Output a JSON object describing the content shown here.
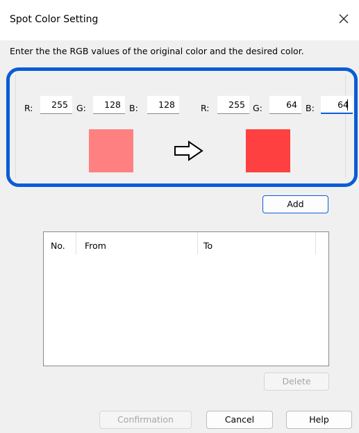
{
  "dialog": {
    "title": "Spot Color Setting",
    "close_glyph": "✕",
    "instruction": "Enter the the RGB values of the original color and the desired color."
  },
  "original": {
    "r_label": "R:",
    "g_label": "G:",
    "b_label": "B:",
    "r": "255",
    "g": "128",
    "b": "128",
    "swatch_color": "#ff8080"
  },
  "desired": {
    "r_label": "R:",
    "g_label": "G:",
    "b_label": "B:",
    "r": "255",
    "g": "64",
    "b": "64",
    "swatch_color": "#ff4040"
  },
  "arrow_icon": "right-arrow-outline",
  "accent_color": "#0a5cd6",
  "add_label": "Add",
  "table": {
    "columns": [
      "No.",
      "From",
      "To"
    ],
    "rows": []
  },
  "delete_label": "Delete",
  "footer": {
    "confirmation_label": "Confirmation",
    "cancel_label": "Cancel",
    "help_label": "Help"
  }
}
